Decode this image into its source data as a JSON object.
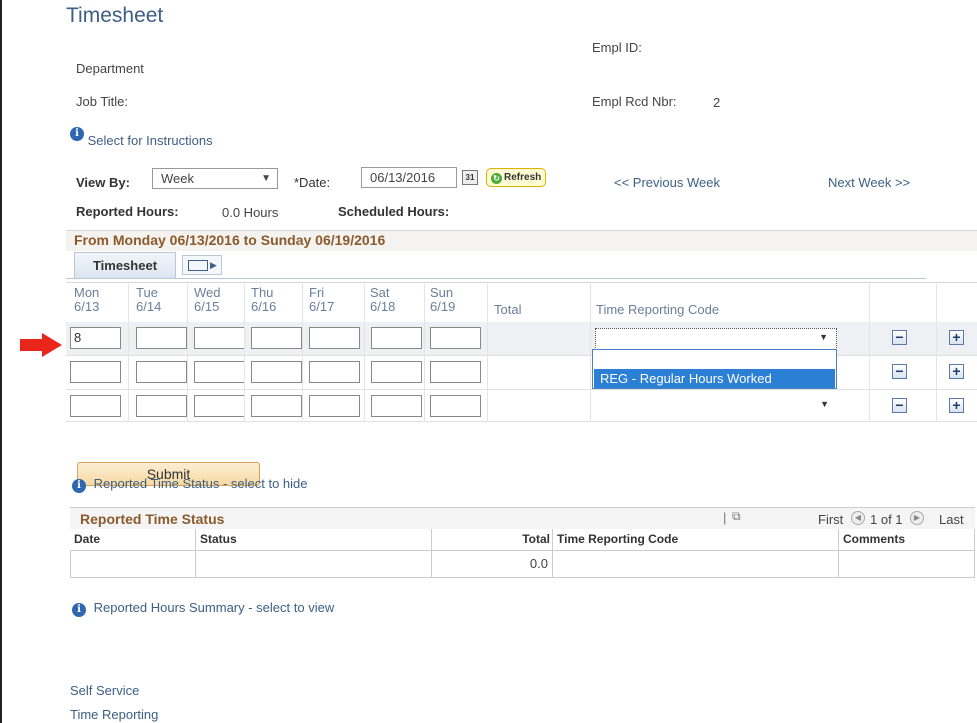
{
  "header": {
    "title": "Timesheet",
    "department_label": "Department",
    "job_title_label": "Job Title:",
    "empl_id_label": "Empl ID:",
    "empl_rcd_label": "Empl Rcd Nbr:",
    "empl_rcd_value": "2",
    "instructions_link": "Select for Instructions"
  },
  "controls": {
    "view_by_label": "View By:",
    "view_by_value": "Week",
    "date_label": "*Date:",
    "date_value": "06/13/2016",
    "calendar_icon_text": "31",
    "refresh_label": "Refresh",
    "prev_week": "<< Previous Week",
    "next_week": "Next Week >>"
  },
  "hours": {
    "reported_label": "Reported Hours:",
    "reported_value": "0.0 Hours",
    "scheduled_label": "Scheduled Hours:"
  },
  "period": {
    "range_text": "From Monday 06/13/2016 to Sunday 06/19/2016",
    "tab_label": "Timesheet"
  },
  "grid": {
    "days": [
      {
        "day": "Mon",
        "date": "6/13"
      },
      {
        "day": "Tue",
        "date": "6/14"
      },
      {
        "day": "Wed",
        "date": "6/15"
      },
      {
        "day": "Thu",
        "date": "6/16"
      },
      {
        "day": "Fri",
        "date": "6/17"
      },
      {
        "day": "Sat",
        "date": "6/18"
      },
      {
        "day": "Sun",
        "date": "6/19"
      }
    ],
    "total_header": "Total",
    "trc_header": "Time Reporting Code",
    "row1_mon_value": "8",
    "dropdown_option": "REG - Regular Hours Worked"
  },
  "submit_label": "Submit",
  "rts": {
    "toggle_link": "Reported Time Status - select to hide",
    "title": "Reported Time Status",
    "nav_first": "First",
    "nav_count": "1 of 1",
    "nav_last": "Last",
    "columns": {
      "date": "Date",
      "status": "Status",
      "total": "Total",
      "trc": "Time Reporting Code",
      "comments": "Comments"
    },
    "total_value": "0.0"
  },
  "summary_link": "Reported Hours Summary - select to view",
  "footer": {
    "self_service": "Self Service",
    "time_reporting": "Time Reporting"
  },
  "colors": {
    "title_blue": "#3d5f85",
    "period_brown": "#8a5a2b",
    "dropdown_highlight": "#2b7fd4",
    "arrow_red": "#e8261c"
  }
}
